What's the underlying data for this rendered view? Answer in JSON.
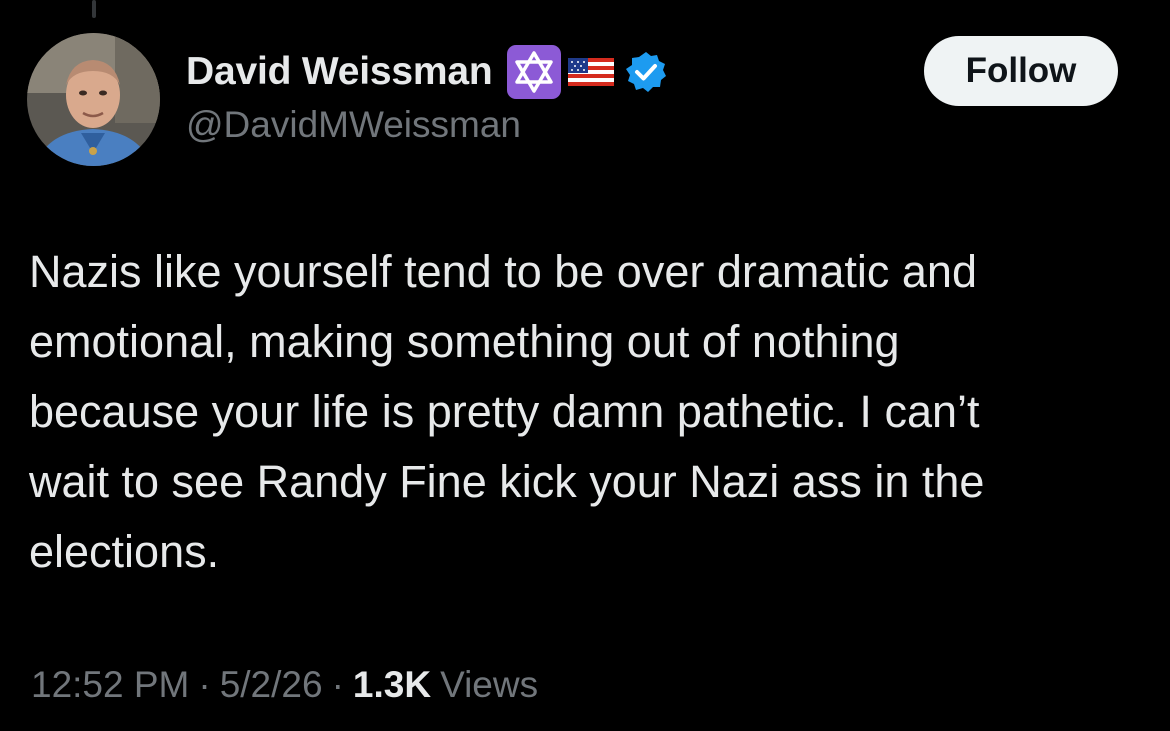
{
  "author": {
    "display_name": "David Weissman",
    "handle": "@DavidMWeissman",
    "badges": [
      "star-of-david-emoji",
      "us-flag-emoji",
      "verified-icon"
    ],
    "verified_color": "#1d9bf0"
  },
  "follow_button": {
    "label": "Follow"
  },
  "tweet": {
    "text": "Nazis like yourself tend to be over dramatic and\nemotional, making something out of nothing\nbecause your life is pretty damn pathetic. I can’t\nwait to see Randy Fine kick your Nazi ass in the\nelections."
  },
  "meta": {
    "time": "12:52 PM",
    "separator": "·",
    "date": "5/2/26",
    "views_count": "1.3K",
    "views_label": "Views"
  },
  "colors": {
    "background": "#000000",
    "primary_text": "#e7e9ea",
    "secondary_text": "#71767b",
    "follow_bg": "#eff3f4",
    "follow_text": "#0f1419",
    "emoji_purple": "#8c5ad6"
  }
}
